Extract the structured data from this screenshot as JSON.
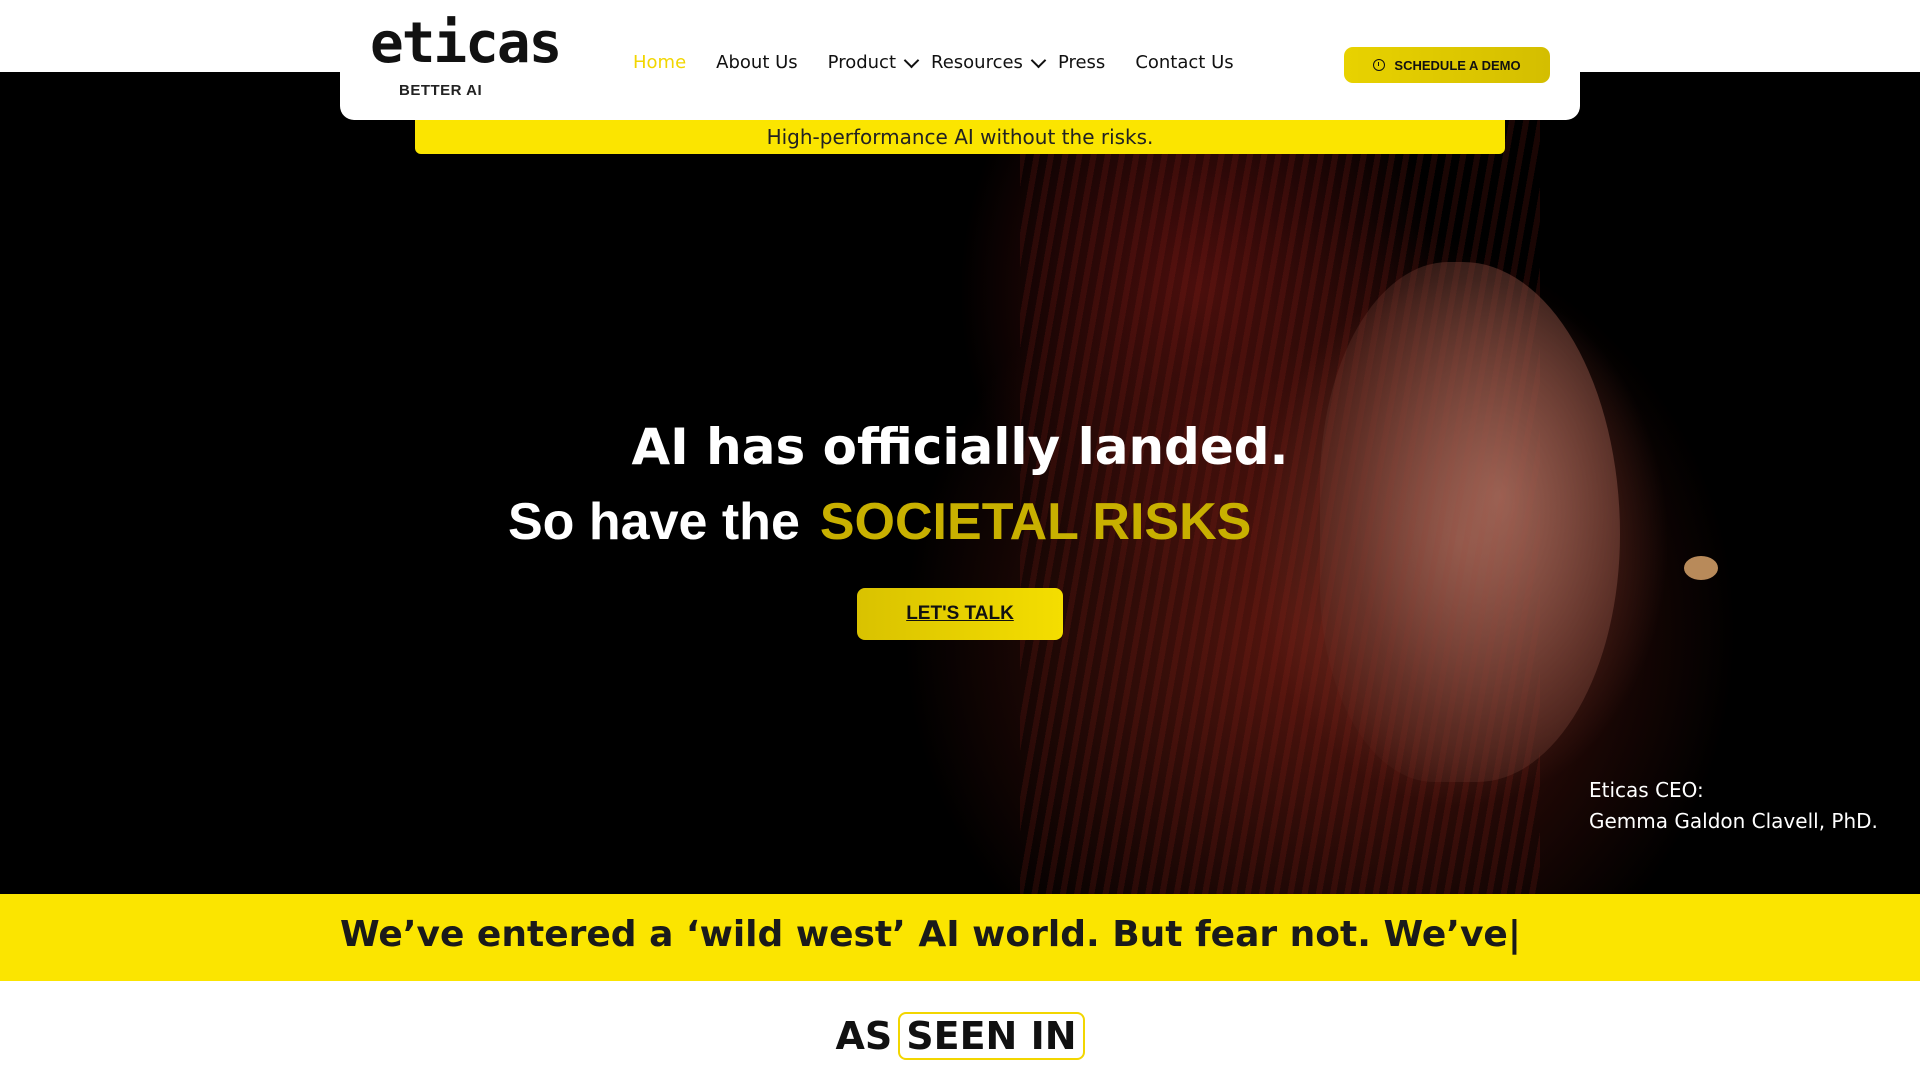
{
  "brand": {
    "logo_text": "eticas",
    "logo_subtitle": "BETTER AI"
  },
  "nav": {
    "items": [
      {
        "label": "Home",
        "active": true
      },
      {
        "label": "About Us"
      },
      {
        "label": "Product",
        "dropdown": true
      },
      {
        "label": "Resources",
        "dropdown": true
      },
      {
        "label": "Press"
      },
      {
        "label": "Contact Us"
      }
    ],
    "cta_label": "SCHEDULE A DEMO",
    "cta_icon": "clock-icon"
  },
  "tagline": "High-performance AI without the risks.",
  "hero": {
    "line1": "AI has officially landed.",
    "line2_prefix": "So have the",
    "line2_accent": "SOCIETAL RISKS",
    "button_label": "LET'S TALK",
    "caption_line1": "Eticas CEO:",
    "caption_line2": "Gemma Galdon Clavell, PhD."
  },
  "banner": {
    "text": "We’ve entered a ‘wild west’ AI world.  But fear not. We’ve|"
  },
  "seen_in": {
    "prefix": "AS",
    "boxed": "SEEN IN"
  },
  "colors": {
    "accent_yellow": "#fbe500",
    "accent_dark_yellow": "#c8b000",
    "hero_background": "#000000"
  }
}
